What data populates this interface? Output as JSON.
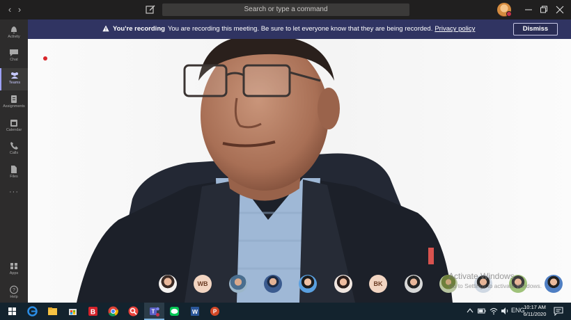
{
  "titlebar": {
    "back_glyph": "‹",
    "forward_glyph": "›",
    "search_placeholder": "Search or type a command"
  },
  "rail": {
    "items": [
      {
        "label": "Activity",
        "icon": "bell-icon"
      },
      {
        "label": "Chat",
        "icon": "chat-icon"
      },
      {
        "label": "Teams",
        "icon": "teams-icon"
      },
      {
        "label": "Assignments",
        "icon": "assignments-icon"
      },
      {
        "label": "Calendar",
        "icon": "calendar-icon"
      },
      {
        "label": "Calls",
        "icon": "phone-icon"
      },
      {
        "label": "Files",
        "icon": "files-icon"
      },
      {
        "label": "Apps",
        "icon": "apps-icon"
      },
      {
        "label": "Help",
        "icon": "help-icon"
      }
    ],
    "more_glyph": "···"
  },
  "banner": {
    "strong": "You're recording",
    "message": "You are recording this meeting. Be sure to let everyone know that they are being recorded.",
    "link": "Privacy policy",
    "dismiss": "Dismiss"
  },
  "participants": {
    "initials_1": "WB",
    "initials_2": "BK"
  },
  "watermark": {
    "title": "Activate Windows",
    "subtitle": "Go to Settings to activate Windows."
  },
  "taskbar": {
    "time": "10:17 AM",
    "date": "6/11/2020",
    "lang": "ENG"
  },
  "colors": {
    "banner": "#303462",
    "rail": "#2d2c2c",
    "titlebar": "#201f1f",
    "taskbar": "#13232e",
    "accent": "#9ea2ff"
  }
}
